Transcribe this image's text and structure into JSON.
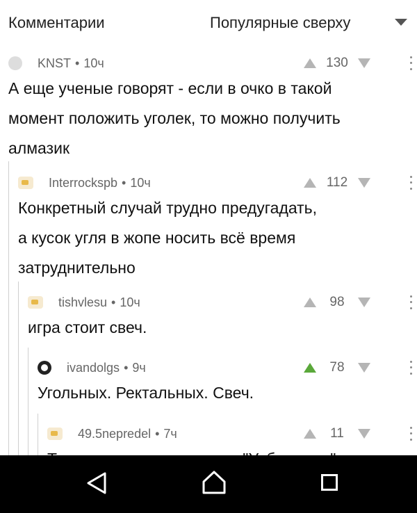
{
  "header": {
    "title": "Комментарии",
    "sort": "Популярные сверху"
  },
  "comments": [
    {
      "author": "KNST",
      "time": "10ч",
      "score": "130",
      "lines": [
        "А еще ученые говорят - если в очко в такой",
        "момент положить уголек, то можно получить",
        "алмазик"
      ]
    },
    {
      "author": "Interrockspb",
      "time": "10ч",
      "score": "112",
      "lines": [
        "Конкретный случай трудно предугадать,",
        "а кусок угля в жопе носить всё время",
        "затруднительно"
      ]
    },
    {
      "author": "tishvlesu",
      "time": "10ч",
      "score": "98",
      "lines": [
        "игра стоит свеч."
      ]
    },
    {
      "author": "ivandolgs",
      "time": "9ч",
      "score": "78",
      "lines": [
        "Угольных. Ректальных. Свеч."
      ]
    },
    {
      "author": "49.5nepredel",
      "time": "7ч",
      "score": "11",
      "lines": [
        "Только в нашем магазине \"Уеба свечи\""
      ]
    }
  ],
  "colors": {
    "upvoted": "#5aa83a",
    "navbar": "#000000"
  },
  "icons": {
    "back": "back-triangle-icon",
    "home": "home-icon",
    "recents": "recents-icon"
  }
}
